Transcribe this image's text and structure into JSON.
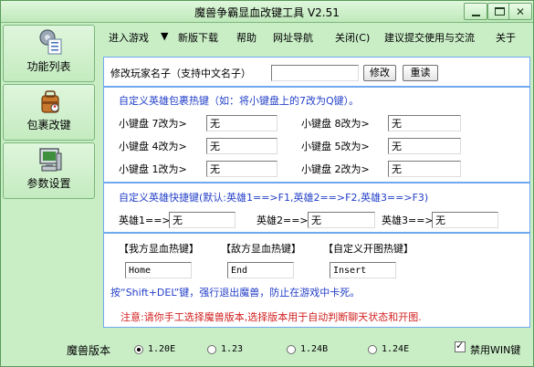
{
  "window": {
    "title": "魔兽争霸显血改键工具 V2.51",
    "minimize_glyph": "",
    "maximize_glyph": "",
    "close_glyph": "✕"
  },
  "nav": {
    "items": [
      {
        "label": "功能列表",
        "icon": "settings-list-icon"
      },
      {
        "label": "包裹改键",
        "icon": "bag-icon"
      },
      {
        "label": "参数设置",
        "icon": "computer-icon"
      }
    ]
  },
  "menu": {
    "items": [
      "进入游戏",
      "▼",
      "新版下载",
      "帮助",
      "网址导航",
      "关闭(C)",
      "建议提交使用与交流",
      "关于"
    ]
  },
  "rename": {
    "label": "修改玩家名子（支持中文名子）",
    "value": "",
    "modify_button": "修改",
    "reset_button": "重读"
  },
  "inventory": {
    "heading": "自定义英雄包裹热键（如：将小键盘上的7改为Q键）。",
    "slots": [
      {
        "label": "小键盘 7改为>",
        "value": "无"
      },
      {
        "label": "小键盘 8改为>",
        "value": "无"
      },
      {
        "label": "小键盘 4改为>",
        "value": "无"
      },
      {
        "label": "小键盘 5改为>",
        "value": "无"
      },
      {
        "label": "小键盘 1改为>",
        "value": "无"
      },
      {
        "label": "小键盘 2改为>",
        "value": "无"
      }
    ]
  },
  "hero": {
    "heading": "自定义英雄快捷键(默认:英雄1==>F1,英雄2==>F2,英雄3==>F3)",
    "items": [
      {
        "label": "英雄1==>",
        "value": "无"
      },
      {
        "label": "英雄2==>",
        "value": "无"
      },
      {
        "label": "英雄3==>",
        "value": "无"
      }
    ]
  },
  "hotkeys": {
    "labels": [
      "【我方显血热键】",
      "【敌方显血热键】",
      "【自定义开图热键】"
    ],
    "values": [
      "Home",
      "End",
      "Insert"
    ],
    "exit_note": "按“Shift+DEL”键，强行退出魔兽，防止在游戏中卡死。",
    "warning": "注意:请你手工选择魔兽版本,选择版本用于自动判断聊天状态和开图."
  },
  "version": {
    "label": "魔兽版本",
    "options": [
      "1.20E",
      "1.23",
      "1.24B",
      "1.24E"
    ],
    "selected": "1.20E",
    "disable_win_label": "禁用WIN键",
    "disable_win_checked": true
  },
  "colors": {
    "window_bg": "#c9eec6",
    "panel_border": "#6fa9ef",
    "heading_blue": "#2440c8",
    "warning_red": "#d22020"
  }
}
